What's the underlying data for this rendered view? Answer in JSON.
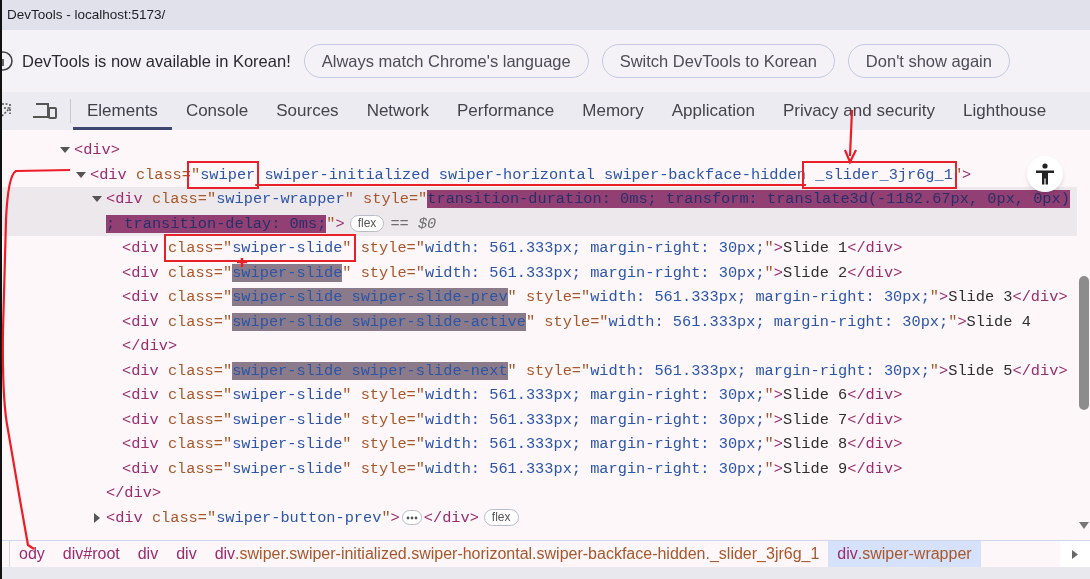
{
  "window": {
    "title": "DevTools - localhost:5173/"
  },
  "infobar": {
    "message": "DevTools is now available in Korean!",
    "buttons": [
      "Always match Chrome's language",
      "Switch DevTools to Korean",
      "Don't show again"
    ]
  },
  "tabs": [
    {
      "label": "Elements",
      "selected": true
    },
    {
      "label": "Console",
      "selected": false
    },
    {
      "label": "Sources",
      "selected": false
    },
    {
      "label": "Network",
      "selected": false
    },
    {
      "label": "Performance",
      "selected": false
    },
    {
      "label": "Memory",
      "selected": false
    },
    {
      "label": "Application",
      "selected": false
    },
    {
      "label": "Privacy and security",
      "selected": false
    },
    {
      "label": "Lighthouse",
      "selected": false
    }
  ],
  "dom_tree": [
    {
      "expanded": true,
      "selected": false,
      "tokens": [
        {
          "kind": "tag",
          "text": "<div>"
        }
      ],
      "children": [
        {
          "expanded": true,
          "selected": false,
          "tokens": [
            {
              "kind": "tag",
              "text": "<div "
            },
            {
              "kind": "attr",
              "text": "class="
            },
            {
              "boxed": true,
              "parts": [
                {
                  "kind": "attr",
                  "text": "\""
                },
                {
                  "kind": "value",
                  "text": "swiper"
                }
              ]
            },
            {
              "kind": "value",
              "text": " swiper-initialized swiper-horizontal swiper-backface-hidden",
              "underlined": true
            },
            {
              "boxed": true,
              "parts": [
                {
                  "kind": "value",
                  "text": " _slider_3jr6g_1"
                }
              ]
            },
            {
              "kind": "attr",
              "text": "\""
            },
            {
              "kind": "tag",
              "text": ">"
            }
          ],
          "children": [
            {
              "expanded": true,
              "selected": true,
              "tokens": [
                {
                  "kind": "tag",
                  "text": "<div "
                },
                {
                  "kind": "attr",
                  "text": "class=\""
                },
                {
                  "kind": "value",
                  "text": "swiper-wrapper"
                },
                {
                  "kind": "attr",
                  "text": "\" style=\""
                },
                {
                  "kind": "value",
                  "text": "transition-duration: 0ms; transform: translate3d(-1182.67px, 0px, 0px)",
                  "highlighted": true,
                  "current": true
                },
                {
                  "kind": "value",
                  "text": "; transition-delay: 0ms;",
                  "highlighted": true,
                  "current": true
                },
                {
                  "kind": "attr",
                  "text": "\""
                },
                {
                  "kind": "tag",
                  "text": ">"
                },
                {
                  "kind": "badge",
                  "text": "flex"
                },
                {
                  "kind": "ref",
                  "text": "== $0"
                }
              ],
              "children": [
                {
                  "selected": false,
                  "tokens": [
                    {
                      "kind": "tag",
                      "text": "<div "
                    },
                    {
                      "boxed": true,
                      "parts": [
                        {
                          "kind": "attr",
                          "text": "class=\""
                        },
                        {
                          "kind": "value",
                          "text": "swiper-slide"
                        },
                        {
                          "kind": "attr",
                          "text": "\""
                        }
                      ]
                    },
                    {
                      "kind": "attr",
                      "text": " style=\""
                    },
                    {
                      "kind": "value",
                      "text": "width: 561.333px; margin-right: 30px;"
                    },
                    {
                      "kind": "attr",
                      "text": "\""
                    },
                    {
                      "kind": "tag",
                      "text": ">"
                    },
                    {
                      "kind": "text",
                      "text": "Slide 1"
                    },
                    {
                      "kind": "tag",
                      "text": "</div>"
                    }
                  ]
                },
                {
                  "selected": false,
                  "tokens": [
                    {
                      "kind": "tag",
                      "text": "<div "
                    },
                    {
                      "kind": "attr",
                      "text": "class=\""
                    },
                    {
                      "kind": "value",
                      "text": "swiper-slide",
                      "highlighted": true,
                      "current": false
                    },
                    {
                      "kind": "attr",
                      "text": "\" style=\""
                    },
                    {
                      "kind": "value",
                      "text": "width: 561.333px; margin-right: 30px;"
                    },
                    {
                      "kind": "attr",
                      "text": "\""
                    },
                    {
                      "kind": "tag",
                      "text": ">"
                    },
                    {
                      "kind": "text",
                      "text": "Slide 2"
                    },
                    {
                      "kind": "tag",
                      "text": "</div>"
                    }
                  ]
                },
                {
                  "selected": false,
                  "tokens": [
                    {
                      "kind": "tag",
                      "text": "<div "
                    },
                    {
                      "kind": "attr",
                      "text": "class=\""
                    },
                    {
                      "kind": "value",
                      "text": "swiper-slide swiper-slide-prev",
                      "highlighted": true,
                      "current": false
                    },
                    {
                      "kind": "attr",
                      "text": "\" style=\""
                    },
                    {
                      "kind": "value",
                      "text": "width: 561.333px; margin-right: 30px;"
                    },
                    {
                      "kind": "attr",
                      "text": "\""
                    },
                    {
                      "kind": "tag",
                      "text": ">"
                    },
                    {
                      "kind": "text",
                      "text": "Slide 3"
                    },
                    {
                      "kind": "tag",
                      "text": "</div>"
                    }
                  ]
                },
                {
                  "selected": false,
                  "tokens": [
                    {
                      "kind": "tag",
                      "text": "<div "
                    },
                    {
                      "kind": "attr",
                      "text": "class=\""
                    },
                    {
                      "kind": "value",
                      "text": "swiper-slide swiper-slide-active",
                      "highlighted": true,
                      "current": false
                    },
                    {
                      "kind": "attr",
                      "text": "\" style=\""
                    },
                    {
                      "kind": "value",
                      "text": "width: 561.333px; margin-right: 30px;"
                    },
                    {
                      "kind": "attr",
                      "text": "\""
                    },
                    {
                      "kind": "tag",
                      "text": ">"
                    },
                    {
                      "kind": "text",
                      "text": "Slide 4"
                    },
                    {
                      "kind": "tag",
                      "text": "</div>"
                    }
                  ]
                },
                {
                  "selected": false,
                  "tokens": [
                    {
                      "kind": "tag",
                      "text": "<div "
                    },
                    {
                      "kind": "attr",
                      "text": "class=\""
                    },
                    {
                      "kind": "value",
                      "text": "swiper-slide swiper-slide-next",
                      "highlighted": true,
                      "current": false
                    },
                    {
                      "kind": "attr",
                      "text": "\" style=\""
                    },
                    {
                      "kind": "value",
                      "text": "width: 561.333px; margin-right: 30px;"
                    },
                    {
                      "kind": "attr",
                      "text": "\""
                    },
                    {
                      "kind": "tag",
                      "text": ">"
                    },
                    {
                      "kind": "text",
                      "text": "Slide 5"
                    },
                    {
                      "kind": "tag",
                      "text": "</div>"
                    }
                  ]
                },
                {
                  "selected": false,
                  "tokens": [
                    {
                      "kind": "tag",
                      "text": "<div "
                    },
                    {
                      "kind": "attr",
                      "text": "class=\""
                    },
                    {
                      "kind": "value",
                      "text": "swiper-slide"
                    },
                    {
                      "kind": "attr",
                      "text": "\" style=\""
                    },
                    {
                      "kind": "value",
                      "text": "width: 561.333px; margin-right: 30px;"
                    },
                    {
                      "kind": "attr",
                      "text": "\""
                    },
                    {
                      "kind": "tag",
                      "text": ">"
                    },
                    {
                      "kind": "text",
                      "text": "Slide 6"
                    },
                    {
                      "kind": "tag",
                      "text": "</div>"
                    }
                  ]
                },
                {
                  "selected": false,
                  "tokens": [
                    {
                      "kind": "tag",
                      "text": "<div "
                    },
                    {
                      "kind": "attr",
                      "text": "class=\""
                    },
                    {
                      "kind": "value",
                      "text": "swiper-slide"
                    },
                    {
                      "kind": "attr",
                      "text": "\" style=\""
                    },
                    {
                      "kind": "value",
                      "text": "width: 561.333px; margin-right: 30px;"
                    },
                    {
                      "kind": "attr",
                      "text": "\""
                    },
                    {
                      "kind": "tag",
                      "text": ">"
                    },
                    {
                      "kind": "text",
                      "text": "Slide 7"
                    },
                    {
                      "kind": "tag",
                      "text": "</div>"
                    }
                  ]
                },
                {
                  "selected": false,
                  "tokens": [
                    {
                      "kind": "tag",
                      "text": "<div "
                    },
                    {
                      "kind": "attr",
                      "text": "class=\""
                    },
                    {
                      "kind": "value",
                      "text": "swiper-slide"
                    },
                    {
                      "kind": "attr",
                      "text": "\" style=\""
                    },
                    {
                      "kind": "value",
                      "text": "width: 561.333px; margin-right: 30px;"
                    },
                    {
                      "kind": "attr",
                      "text": "\""
                    },
                    {
                      "kind": "tag",
                      "text": ">"
                    },
                    {
                      "kind": "text",
                      "text": "Slide 8"
                    },
                    {
                      "kind": "tag",
                      "text": "</div>"
                    }
                  ]
                },
                {
                  "selected": false,
                  "tokens": [
                    {
                      "kind": "tag",
                      "text": "<div "
                    },
                    {
                      "kind": "attr",
                      "text": "class=\""
                    },
                    {
                      "kind": "value",
                      "text": "swiper-slide"
                    },
                    {
                      "kind": "attr",
                      "text": "\" style=\""
                    },
                    {
                      "kind": "value",
                      "text": "width: 561.333px; margin-right: 30px;"
                    },
                    {
                      "kind": "attr",
                      "text": "\""
                    },
                    {
                      "kind": "tag",
                      "text": ">"
                    },
                    {
                      "kind": "text",
                      "text": "Slide 9"
                    },
                    {
                      "kind": "tag",
                      "text": "</div>"
                    }
                  ]
                }
              ],
              "closing": [
                {
                  "kind": "tag",
                  "text": "</div>"
                }
              ]
            },
            {
              "expanded": false,
              "selected": false,
              "tokens": [
                {
                  "kind": "tag",
                  "text": "<div "
                },
                {
                  "kind": "attr",
                  "text": "class=\""
                },
                {
                  "kind": "value",
                  "text": "swiper-button-prev"
                },
                {
                  "kind": "attr",
                  "text": "\""
                },
                {
                  "kind": "tag",
                  "text": ">"
                },
                {
                  "kind": "ellipsis"
                },
                {
                  "kind": "tag",
                  "text": "</div>"
                },
                {
                  "kind": "badge",
                  "text": "flex"
                }
              ]
            }
          ]
        }
      ]
    }
  ],
  "breadcrumbs": [
    {
      "selected": false,
      "parts": [
        {
          "kind": "tag",
          "text": "ody"
        }
      ]
    },
    {
      "selected": false,
      "parts": [
        {
          "kind": "tag",
          "text": "div#root"
        }
      ]
    },
    {
      "selected": false,
      "parts": [
        {
          "kind": "tag",
          "text": "div"
        }
      ]
    },
    {
      "selected": false,
      "parts": [
        {
          "kind": "tag",
          "text": "div"
        }
      ]
    },
    {
      "selected": false,
      "parts": [
        {
          "kind": "tag",
          "text": "div"
        },
        {
          "kind": "attr",
          "text": ".swiper.swiper-initialized.swiper-horizontal.swiper-backface-hidden._slider_3jr6g_1"
        }
      ]
    },
    {
      "selected": true,
      "parts": [
        {
          "kind": "tag",
          "text": "div"
        },
        {
          "kind": "attr",
          "text": ".swiper-wrapper"
        }
      ]
    }
  ]
}
